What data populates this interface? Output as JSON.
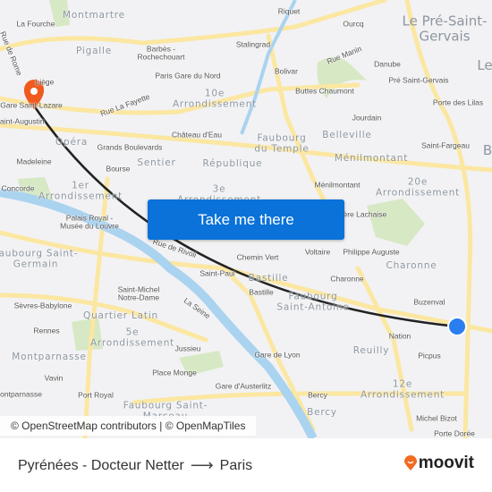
{
  "map": {
    "labels": [
      {
        "text": "Montmartre",
        "style": "district"
      },
      {
        "text": "La Fourche",
        "style": "street"
      },
      {
        "text": "Riquet",
        "style": "street"
      },
      {
        "text": "Ourcq",
        "style": "street"
      },
      {
        "text": "Le Pré-Saint-\nGervais",
        "style": "city"
      },
      {
        "text": "Le",
        "style": "city"
      },
      {
        "text": "Stalingrad",
        "style": "street"
      },
      {
        "text": "Rue Manin",
        "style": "street"
      },
      {
        "text": "Pigalle",
        "style": "district"
      },
      {
        "text": "Barbès -\nRochechouart",
        "style": "street"
      },
      {
        "text": "Bolivar",
        "style": "street"
      },
      {
        "text": "Danube",
        "style": "street"
      },
      {
        "text": "Paris Gare du Nord",
        "style": "street"
      },
      {
        "text": "Pré Saint-Gervais",
        "style": "street"
      },
      {
        "text": "10e\nArrondissement",
        "style": "district"
      },
      {
        "text": "Buttes Chaumont",
        "style": "street"
      },
      {
        "text": "Porte des Lilas",
        "style": "street"
      },
      {
        "text": "Rue La Fayette",
        "style": "street"
      },
      {
        "text": "Liège",
        "style": "street"
      },
      {
        "text": "Gare Saint-Lazare",
        "style": "street"
      },
      {
        "text": "Saint-Augustin",
        "style": "street"
      },
      {
        "text": "Jourdain",
        "style": "street"
      },
      {
        "text": "Château d'Eau",
        "style": "street"
      },
      {
        "text": "Faubourg\ndu Temple",
        "style": "district"
      },
      {
        "text": "Belleville",
        "style": "district"
      },
      {
        "text": "Opéra",
        "style": "district"
      },
      {
        "text": "Grands Boulevards",
        "style": "street"
      },
      {
        "text": "Saint-Fargeau",
        "style": "street"
      },
      {
        "text": "B",
        "style": "city"
      },
      {
        "text": "Ménilmontant",
        "style": "district"
      },
      {
        "text": "Madeleine",
        "style": "street"
      },
      {
        "text": "Bourse",
        "style": "street"
      },
      {
        "text": "Sentier",
        "style": "district"
      },
      {
        "text": "République",
        "style": "district"
      },
      {
        "text": "1er\nArrondissement",
        "style": "district"
      },
      {
        "text": "Concorde",
        "style": "street"
      },
      {
        "text": "Ménilmontant",
        "style": "street"
      },
      {
        "text": "20e\nArrondissement",
        "style": "district"
      },
      {
        "text": "3e\nArrondissement",
        "style": "district"
      },
      {
        "text": "Palais Royal -\nMusée du Louvre",
        "style": "street"
      },
      {
        "text": "Père Lachaise",
        "style": "street"
      },
      {
        "text": "Faubourg Saint-\nGermain",
        "style": "district"
      },
      {
        "text": "Rue de Rivoli",
        "style": "street"
      },
      {
        "text": "Chemin Vert",
        "style": "street"
      },
      {
        "text": "Voltaire",
        "style": "street"
      },
      {
        "text": "Philippe Auguste",
        "style": "street"
      },
      {
        "text": "Bastille",
        "style": "district"
      },
      {
        "text": "Charonne",
        "style": "district"
      },
      {
        "text": "Saint-Paul",
        "style": "street"
      },
      {
        "text": "Charonne",
        "style": "street"
      },
      {
        "text": "Saint-Michel\nNotre-Dame",
        "style": "street"
      },
      {
        "text": "Bastille",
        "style": "street"
      },
      {
        "text": "Faubourg\nSaint-Antoine",
        "style": "district"
      },
      {
        "text": "Buzenval",
        "style": "street"
      },
      {
        "text": "Sèvres-Babylone",
        "style": "street"
      },
      {
        "text": "Quartier Latin",
        "style": "district"
      },
      {
        "text": "La Seine",
        "style": "street"
      },
      {
        "text": "Rennes",
        "style": "street"
      },
      {
        "text": "5e\nArrondissement",
        "style": "district"
      },
      {
        "text": "Nation",
        "style": "street"
      },
      {
        "text": "Jussieu",
        "style": "street"
      },
      {
        "text": "Montparnasse",
        "style": "district"
      },
      {
        "text": "Reuilly",
        "style": "district"
      },
      {
        "text": "Picpus",
        "style": "street"
      },
      {
        "text": "Gare de Lyon",
        "style": "street"
      },
      {
        "text": "Place Monge",
        "style": "street"
      },
      {
        "text": "Vavin",
        "style": "street"
      },
      {
        "text": "Port Royal",
        "style": "street"
      },
      {
        "text": "Montparnasse",
        "style": "street"
      },
      {
        "text": "Gare d'Austerlitz",
        "style": "street"
      },
      {
        "text": "Bercy",
        "style": "street"
      },
      {
        "text": "12e\nArrondissement",
        "style": "district"
      },
      {
        "text": "Faubourg Saint-\nMarceau",
        "style": "district"
      },
      {
        "text": "Bercy",
        "style": "district"
      },
      {
        "text": "Michel Bizot",
        "style": "street"
      },
      {
        "text": "Porte Dorée",
        "style": "street"
      },
      {
        "text": "Rue de Rome",
        "style": "street"
      }
    ],
    "origin_pin_color": "#f05a1e",
    "destination_dot_color": "#2a7ef0",
    "route_color": "#222222",
    "river_color": "#aad3f0",
    "road_color": "#fbe7a1",
    "park_color": "#cfe3b8"
  },
  "cta": {
    "label": "Take me there",
    "color": "#0a72d8"
  },
  "attribution": "© OpenStreetMap contributors | © OpenMapTiles",
  "footer": {
    "origin": "Pyrénées - Docteur Netter",
    "destination": "Paris",
    "brand": "moovit",
    "brand_color": "#f26b21"
  }
}
